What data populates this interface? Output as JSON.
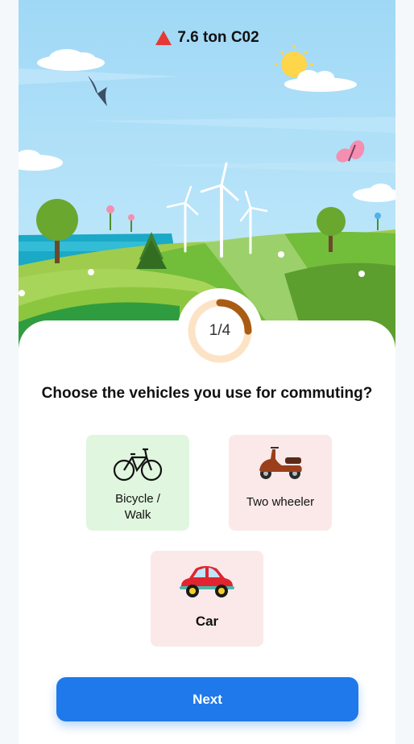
{
  "header": {
    "co2_text": "7.6 ton C02",
    "co2_icon": "warning-triangle-icon",
    "co2_color": "#e53935"
  },
  "progress": {
    "label": "1/4",
    "current": 1,
    "total": 4,
    "track_color": "#fde3c6",
    "fill_color": "#a95c14"
  },
  "question": {
    "text": "Choose the vehicles you use for commuting?"
  },
  "options": [
    {
      "label_line1": "Bicycle /",
      "label_line2": "Walk",
      "icon": "bicycle-icon",
      "bg": "#e0f6df",
      "selected": true
    },
    {
      "label": "Two wheeler",
      "icon": "scooter-icon",
      "bg": "#fbe9e9",
      "selected": false
    },
    {
      "label": "Car",
      "icon": "car-icon",
      "bg": "#fbe9e9",
      "selected": false
    }
  ],
  "next_button": {
    "label": "Next",
    "color": "#1f79ea"
  }
}
